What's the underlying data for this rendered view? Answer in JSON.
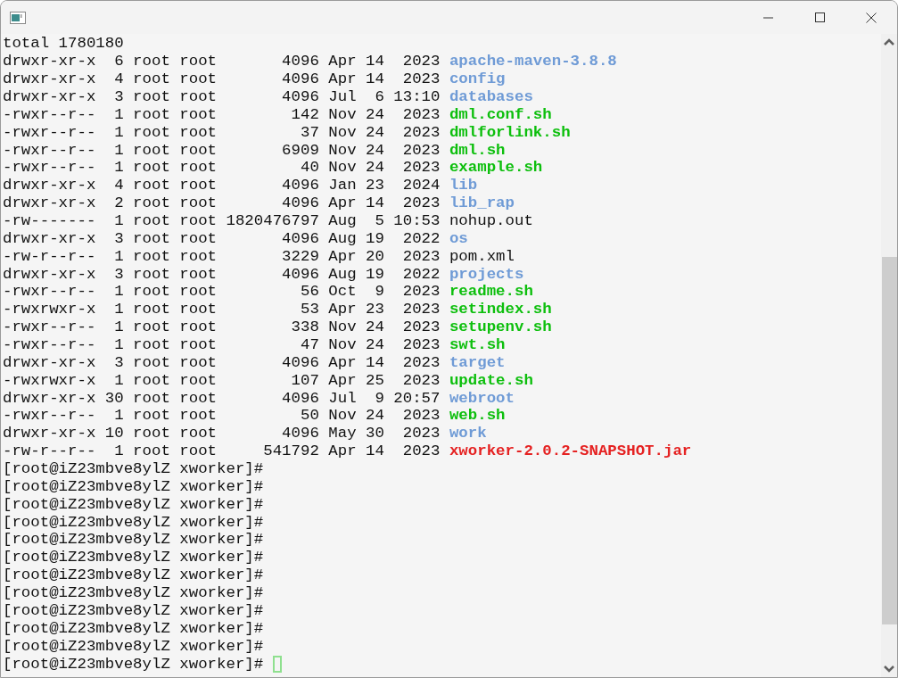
{
  "lines": [
    {
      "kind": "text",
      "text": "total 1780180"
    },
    {
      "kind": "entry",
      "info": "drwxr-xr-x  6 root root       4096 Apr 14  2023",
      "name": "apache-maven-3.8.8",
      "color": "#6f9bd6"
    },
    {
      "kind": "entry",
      "info": "drwxr-xr-x  4 root root       4096 Apr 14  2023",
      "name": "config",
      "color": "#6f9bd6"
    },
    {
      "kind": "entry",
      "info": "drwxr-xr-x  3 root root       4096 Jul  6 13:10",
      "name": "databases",
      "color": "#6f9bd6"
    },
    {
      "kind": "entry",
      "info": "-rwxr--r--  1 root root        142 Nov 24  2023",
      "name": "dml.conf.sh",
      "color": "#0dbf0d"
    },
    {
      "kind": "entry",
      "info": "-rwxr--r--  1 root root         37 Nov 24  2023",
      "name": "dmlforlink.sh",
      "color": "#0dbf0d"
    },
    {
      "kind": "entry",
      "info": "-rwxr--r--  1 root root       6909 Nov 24  2023",
      "name": "dml.sh",
      "color": "#0dbf0d"
    },
    {
      "kind": "entry",
      "info": "-rwxr--r--  1 root root         40 Nov 24  2023",
      "name": "example.sh",
      "color": "#0dbf0d"
    },
    {
      "kind": "entry",
      "info": "drwxr-xr-x  4 root root       4096 Jan 23  2024",
      "name": "lib",
      "color": "#6f9bd6"
    },
    {
      "kind": "entry",
      "info": "drwxr-xr-x  2 root root       4096 Apr 14  2023",
      "name": "lib_rap",
      "color": "#6f9bd6"
    },
    {
      "kind": "entry",
      "info": "-rw-------  1 root root 1820476797 Aug  5 10:53",
      "name": "nohup.out"
    },
    {
      "kind": "entry",
      "info": "drwxr-xr-x  3 root root       4096 Aug 19  2022",
      "name": "os",
      "color": "#6f9bd6"
    },
    {
      "kind": "entry",
      "info": "-rw-r--r--  1 root root       3229 Apr 20  2023",
      "name": "pom.xml"
    },
    {
      "kind": "entry",
      "info": "drwxr-xr-x  3 root root       4096 Aug 19  2022",
      "name": "projects",
      "color": "#6f9bd6"
    },
    {
      "kind": "entry",
      "info": "-rwxr--r--  1 root root         56 Oct  9  2023",
      "name": "readme.sh",
      "color": "#0dbf0d"
    },
    {
      "kind": "entry",
      "info": "-rwxrwxr-x  1 root root         53 Apr 23  2023",
      "name": "setindex.sh",
      "color": "#0dbf0d"
    },
    {
      "kind": "entry",
      "info": "-rwxr--r--  1 root root        338 Nov 24  2023",
      "name": "setupenv.sh",
      "color": "#0dbf0d"
    },
    {
      "kind": "entry",
      "info": "-rwxr--r--  1 root root         47 Nov 24  2023",
      "name": "swt.sh",
      "color": "#0dbf0d"
    },
    {
      "kind": "entry",
      "info": "drwxr-xr-x  3 root root       4096 Apr 14  2023",
      "name": "target",
      "color": "#6f9bd6"
    },
    {
      "kind": "entry",
      "info": "-rwxrwxr-x  1 root root        107 Apr 25  2023",
      "name": "update.sh",
      "color": "#0dbf0d"
    },
    {
      "kind": "entry",
      "info": "drwxr-xr-x 30 root root       4096 Jul  9 20:57",
      "name": "webroot",
      "color": "#6f9bd6"
    },
    {
      "kind": "entry",
      "info": "-rwxr--r--  1 root root         50 Nov 24  2023",
      "name": "web.sh",
      "color": "#0dbf0d"
    },
    {
      "kind": "entry",
      "info": "drwxr-xr-x 10 root root       4096 May 30  2023",
      "name": "work",
      "color": "#6f9bd6"
    },
    {
      "kind": "entry",
      "info": "-rw-r--r--  1 root root     541792 Apr 14  2023",
      "name": "xworker-2.0.2-SNAPSHOT.jar",
      "color": "#e52222"
    },
    {
      "kind": "prompt",
      "text": "[root@iZ23mbve8ylZ xworker]#",
      "cursor": false
    },
    {
      "kind": "prompt",
      "text": "[root@iZ23mbve8ylZ xworker]#",
      "cursor": false
    },
    {
      "kind": "prompt",
      "text": "[root@iZ23mbve8ylZ xworker]#",
      "cursor": false
    },
    {
      "kind": "prompt",
      "text": "[root@iZ23mbve8ylZ xworker]#",
      "cursor": false
    },
    {
      "kind": "prompt",
      "text": "[root@iZ23mbve8ylZ xworker]#",
      "cursor": false
    },
    {
      "kind": "prompt",
      "text": "[root@iZ23mbve8ylZ xworker]#",
      "cursor": false
    },
    {
      "kind": "prompt",
      "text": "[root@iZ23mbve8ylZ xworker]#",
      "cursor": false
    },
    {
      "kind": "prompt",
      "text": "[root@iZ23mbve8ylZ xworker]#",
      "cursor": false
    },
    {
      "kind": "prompt",
      "text": "[root@iZ23mbve8ylZ xworker]#",
      "cursor": false
    },
    {
      "kind": "prompt",
      "text": "[root@iZ23mbve8ylZ xworker]#",
      "cursor": false
    },
    {
      "kind": "prompt",
      "text": "[root@iZ23mbve8ylZ xworker]#",
      "cursor": false
    },
    {
      "kind": "prompt",
      "text": "[root@iZ23mbve8ylZ xworker]#",
      "cursor": true
    }
  ]
}
